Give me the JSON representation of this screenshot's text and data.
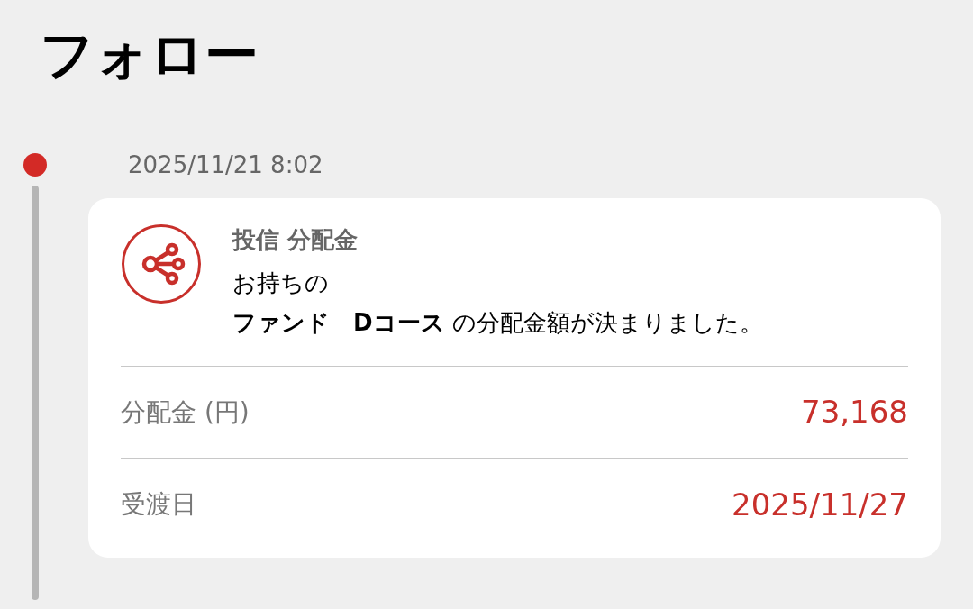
{
  "title": "フォロー",
  "events": [
    {
      "time": "2025/11/21 8:02",
      "category": "投信 分配金",
      "message_lines": [
        "お持ちの",
        "**ファンド　Dコース** の分配金額が決まりました。"
      ],
      "details": [
        {
          "label": "分配金 (円)",
          "value": "73,168"
        },
        {
          "label": "受渡日",
          "value": "2025/11/27"
        }
      ]
    }
  ]
}
